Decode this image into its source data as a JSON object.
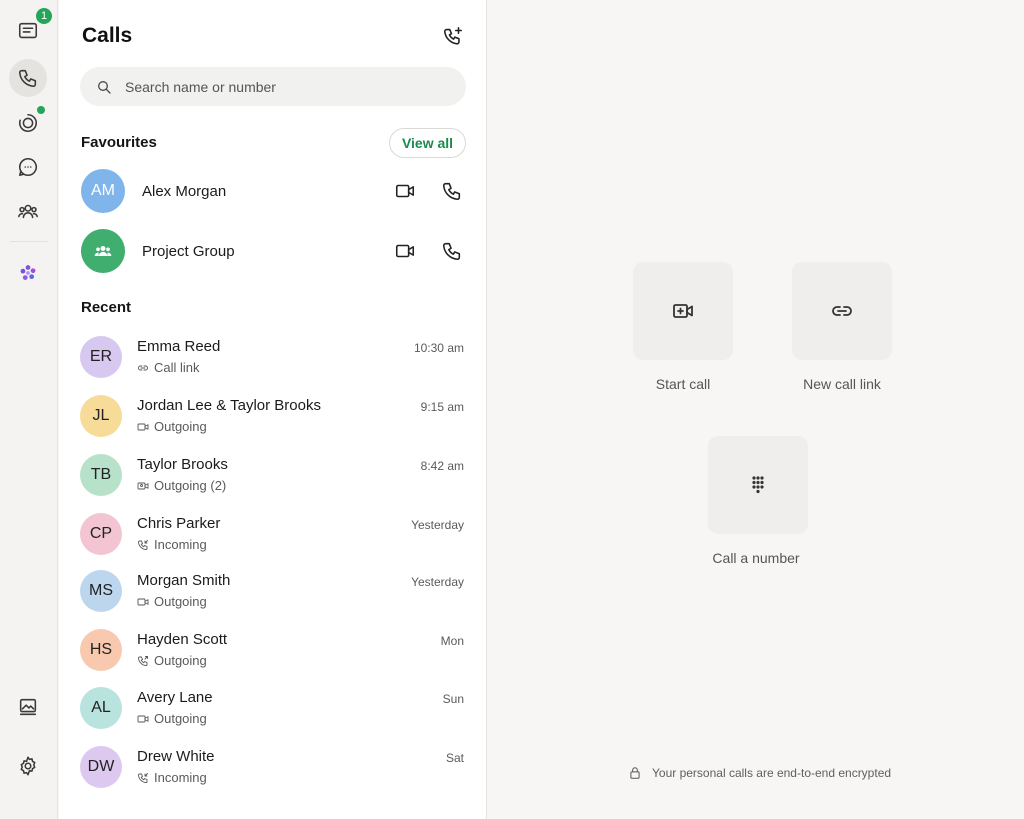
{
  "rail": {
    "chats_badge": "1",
    "items": [
      "chats",
      "calls",
      "status",
      "channels",
      "communities",
      "meta-ai",
      "media",
      "settings"
    ]
  },
  "calls": {
    "title": "Calls",
    "search_placeholder": "Search name or number",
    "favourites_heading": "Favourites",
    "view_all_label": "View all",
    "favourites": [
      {
        "initials": "AM",
        "name": "Alex Morgan",
        "color": "#7fb5ea"
      },
      {
        "initials": "",
        "name": "Project Group",
        "color": "#3fae6e"
      }
    ],
    "recent_heading": "Recent",
    "recent": [
      {
        "initials": "ER",
        "name": "Emma Reed",
        "detail": "Call link",
        "icon": "link-icon",
        "time": "10:30 am",
        "color": "#d6c8ef"
      },
      {
        "initials": "JL",
        "name": "Jordan Lee & Taylor Brooks",
        "detail": "Outgoing",
        "icon": "video-icon",
        "time": "9:15 am",
        "color": "#f6dc98"
      },
      {
        "initials": "TB",
        "name": "Taylor Brooks",
        "detail": "Outgoing (2)",
        "icon": "video-group-icon",
        "time": "8:42 am",
        "color": "#b7e2c9"
      },
      {
        "initials": "CP",
        "name": "Chris Parker",
        "detail": "Incoming",
        "icon": "phone-incoming-icon",
        "time": "Yesterday",
        "color": "#f3c5d2"
      },
      {
        "initials": "MS",
        "name": "Morgan Smith",
        "detail": "Outgoing",
        "icon": "video-icon",
        "time": "Yesterday",
        "color": "#bcd6ee"
      },
      {
        "initials": "HS",
        "name": "Hayden Scott",
        "detail": "Outgoing",
        "icon": "phone-outgoing-icon",
        "time": "Mon",
        "color": "#f8c9ae"
      },
      {
        "initials": "AL",
        "name": "Avery Lane",
        "detail": "Outgoing",
        "icon": "video-icon",
        "time": "Sun",
        "color": "#b8e3df"
      },
      {
        "initials": "DW",
        "name": "Drew White",
        "detail": "Incoming",
        "icon": "phone-incoming-icon",
        "time": "Sat",
        "color": "#ddc9ef"
      }
    ]
  },
  "actions": {
    "start_call": "Start call",
    "new_call_link": "New call link",
    "call_a_number": "Call a number",
    "encryption_note": "Your personal calls are end-to-end encrypted"
  }
}
